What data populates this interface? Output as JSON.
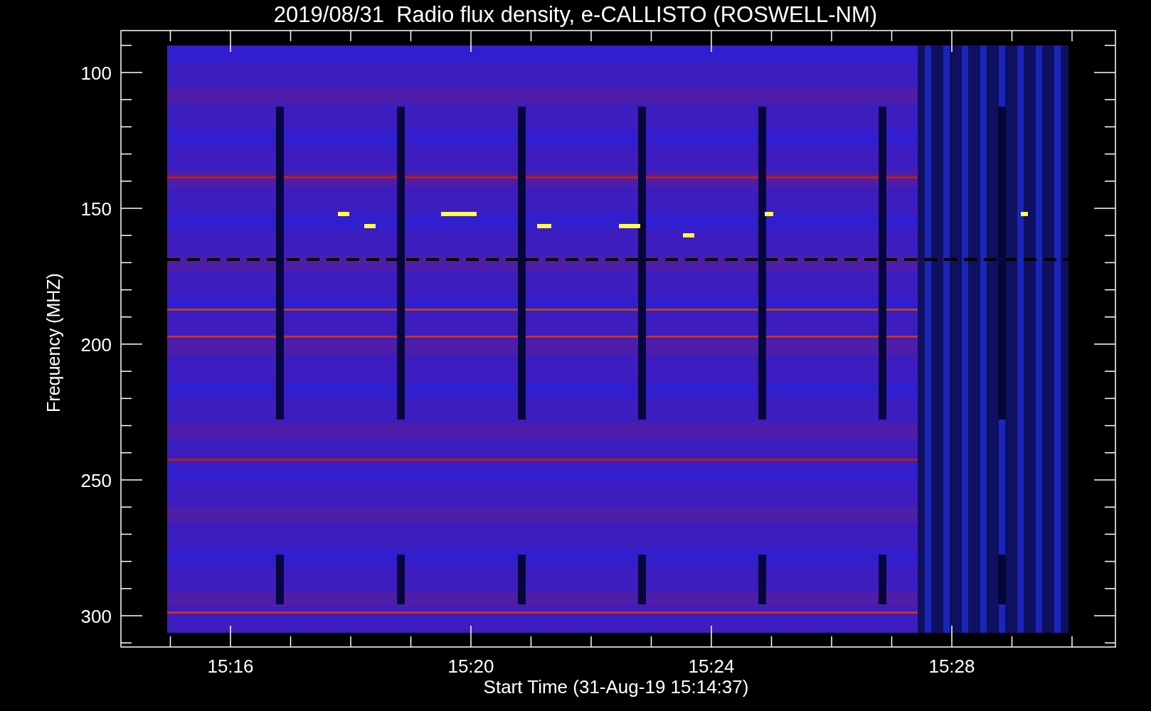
{
  "title": "2019/08/31  Radio flux density, e-CALLISTO (ROSWELL-NM)",
  "y_axis": {
    "label": "Frequency (MHZ)",
    "ticks": [
      "100",
      "150",
      "200",
      "250",
      "300"
    ]
  },
  "x_axis": {
    "label": "Start Time (31-Aug-19 15:14:37)",
    "ticks": [
      "15:16",
      "15:20",
      "15:24",
      "15:28"
    ]
  }
}
